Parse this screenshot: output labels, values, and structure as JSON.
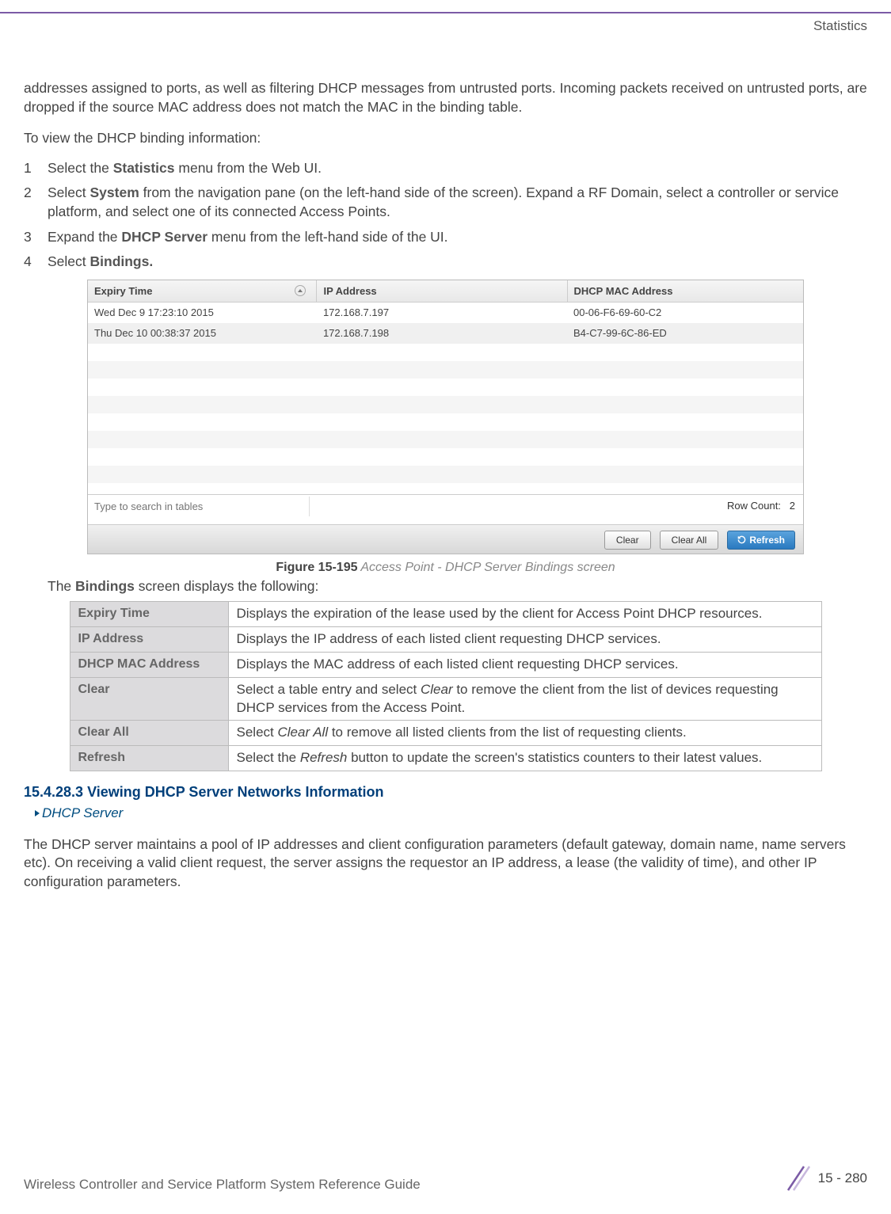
{
  "header": {
    "label": "Statistics"
  },
  "intro": "addresses assigned to ports, as well as filtering DHCP messages from untrusted ports. Incoming packets received on untrusted ports, are dropped if the source MAC address does not match the MAC in the binding table.",
  "lead_in": "To view the DHCP binding information:",
  "steps": {
    "s1_a": "Select the ",
    "s1_bold": "Statistics",
    "s1_b": " menu from the Web UI.",
    "s2_a": "Select ",
    "s2_bold": "System",
    "s2_b": " from the navigation pane (on the left-hand side of the screen). Expand a RF Domain, select a controller or service platform, and select one of its connected Access Points.",
    "s3_a": "Expand the ",
    "s3_bold": "DHCP Server",
    "s3_b": " menu from the left-hand side of the UI.",
    "s4_a": "Select ",
    "s4_bold": "Bindings."
  },
  "ui": {
    "headers": {
      "expiry": "Expiry Time",
      "ip": "IP Address",
      "mac": "DHCP MAC Address"
    },
    "rows": [
      {
        "expiry": "Wed Dec  9 17:23:10 2015",
        "ip": "172.168.7.197",
        "mac": "00-06-F6-69-60-C2"
      },
      {
        "expiry": "Thu Dec 10 00:38:37 2015",
        "ip": "172.168.7.198",
        "mac": "B4-C7-99-6C-86-ED"
      }
    ],
    "search_placeholder": "Type to search in tables",
    "row_count_label": "Row Count:",
    "row_count_value": "2",
    "buttons": {
      "clear": "Clear",
      "clear_all": "Clear All",
      "refresh": "Refresh"
    }
  },
  "figure": {
    "num": "Figure 15-195",
    "title": "  Access Point - DHCP Server Bindings screen"
  },
  "bindings_desc_lead_a": "The ",
  "bindings_desc_lead_bold": "Bindings",
  "bindings_desc_lead_b": " screen displays the following:",
  "desc": {
    "expiry": {
      "label": "Expiry Time",
      "text": "Displays the expiration of the lease used by the client for Access Point DHCP resources."
    },
    "ip": {
      "label": "IP Address",
      "text": "Displays the IP address of each listed client requesting DHCP services."
    },
    "mac": {
      "label": "DHCP MAC Address",
      "text": "Displays the MAC address of each listed client requesting DHCP services."
    },
    "clear": {
      "label": "Clear",
      "text_a": "Select a table entry and select ",
      "italic": "Clear",
      "text_b": " to remove the client from the list of devices requesting DHCP services from the Access Point."
    },
    "clear_all": {
      "label": "Clear All",
      "text_a": "Select ",
      "italic": "Clear All",
      "text_b": " to remove all listed clients from the list of requesting clients."
    },
    "refresh": {
      "label": "Refresh",
      "text_a": "Select the ",
      "italic": "Refresh",
      "text_b": " button to update the screen's statistics counters to their latest values."
    }
  },
  "section": {
    "heading": "15.4.28.3  Viewing DHCP Server Networks Information",
    "breadcrumb": "DHCP Server"
  },
  "section_para": "The DHCP server maintains a pool of IP addresses and client configuration parameters (default gateway, domain name, name servers etc). On receiving a valid client request, the server assigns the requestor an IP address, a lease (the validity of time), and other IP configuration parameters.",
  "footer": {
    "title": "Wireless Controller and Service Platform System Reference Guide",
    "page": "15 - 280"
  }
}
